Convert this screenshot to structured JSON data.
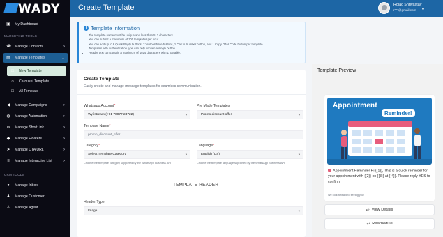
{
  "brand": "WADY",
  "header": {
    "title": "Create Template",
    "user_name": "Rolac Shrivastav",
    "user_email": "r***@gmail.com"
  },
  "sidebar": {
    "dashboard": "My Dashboard",
    "marketing_section": "MARKETING TOOLS",
    "marketing_items": [
      "Manage Contacts",
      "Manage Templates"
    ],
    "template_subitems": [
      "New Template",
      "Carousel Template",
      "All Template"
    ],
    "marketing_items_2": [
      "Manage Campaigns",
      "Manage Automation",
      "Manage ShortLink",
      "Manage Floaters",
      "Manage CTA URL",
      "Manage Interactive List"
    ],
    "crm_section": "CRM TOOLS",
    "crm_items": [
      "Manage Inbox",
      "Manage Customer",
      "Manage Agent"
    ]
  },
  "info": {
    "title": "Template Information",
    "items": [
      "The template name must be unique and less than 512 characters.",
      "You can submit a maximum of 100 templates per hour.",
      "You can add up to 6 Quick Reply buttons, 2 Visit Website buttons, 1 Call to Number button, and 1 Copy Offer Code button per template.",
      "Templates with authentication type can only contain a single button.",
      "Header text can contain a maximum of 1024 characters with 1 variable."
    ]
  },
  "form": {
    "title": "Create Template",
    "subtitle": "Easily create and manage message templates for seamless communication.",
    "whatsapp_label": "Whatsapp Account",
    "whatsapp_value": "Wyfistream (+91 70077 24722)",
    "premade_label": "Pre Made Templates",
    "premade_value": "Promo discount offer",
    "name_label": "Template Name",
    "name_value": "promo_discount_offer",
    "category_label": "Category",
    "category_value": "Select Template Category",
    "category_help": "Choose the template category supported by the WhatsApp Business API",
    "language_label": "Language",
    "language_value": "English (US)",
    "language_help": "Choose the template language supported by the WhatsApp Business API",
    "section_header": "TEMPLATE HEADER",
    "header_type_label": "Header Type",
    "header_type_value": "Image"
  },
  "preview": {
    "title": "Template Preview",
    "banner_line1": "Appointment",
    "banner_line2": "Reminder!",
    "message": "Appointment Reminder Hi {{1}}, This is a quick reminder for your appointment with {{2}} on {{3}} at {{4}}. Please reply YES to confirm.",
    "footer": "We look forward to seeing you!",
    "buttons": [
      "View Details",
      "Reschedule"
    ]
  },
  "colors": {
    "primary": "#1d66a5",
    "sidebar": "#0b0b14",
    "accent": "#2a86d6"
  }
}
